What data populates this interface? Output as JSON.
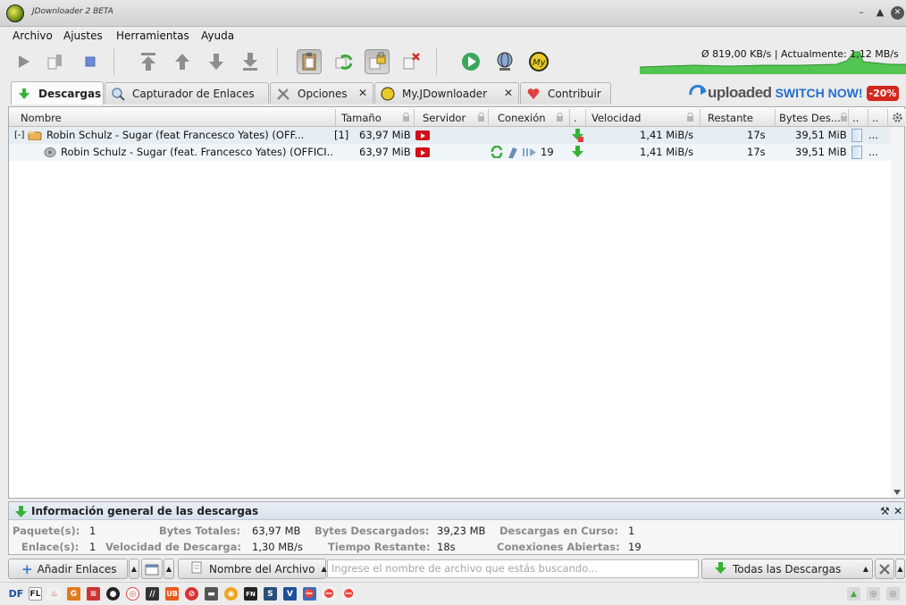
{
  "window": {
    "title": "JDownloader 2 BETA"
  },
  "menu": [
    "Archivo",
    "Ajustes",
    "Herramientas",
    "Ayuda"
  ],
  "speed": {
    "text": "Ø 819,00 KB/s | Actualmente: 1,12 MB/s"
  },
  "tabs": [
    {
      "label": "Descargas"
    },
    {
      "label": "Capturador de Enlaces"
    },
    {
      "label": "Opciones"
    },
    {
      "label": "My.JDownloader"
    },
    {
      "label": "Contribuir"
    }
  ],
  "ad": {
    "brand": "uploaded",
    "cta": "SWITCH NOW!",
    "badge": "-20%"
  },
  "columns": [
    "Nombre",
    "Tamaño",
    "Servidor",
    "Conexión",
    "Velocidad",
    "Restante",
    "Bytes Des..."
  ],
  "rows": {
    "package": {
      "expander": "[-]",
      "name": "Robin Schulz - Sugar (feat  Francesco Yates) (OFF...",
      "count": "[1]",
      "size": "63,97 MiB",
      "speed": "1,41 MiB/s",
      "remaining": "17s",
      "bytes": "39,51 MiB",
      "more": "..."
    },
    "link": {
      "name": "Robin Schulz - Sugar (feat. Francesco Yates) (OFFICI...",
      "size": "63,97 MiB",
      "connections": "19",
      "speed": "1,41 MiB/s",
      "remaining": "17s",
      "bytes": "39,51 MiB",
      "more": "..."
    }
  },
  "info": {
    "title": "Información general de las descargas",
    "labels": {
      "packages": "Paquete(s):",
      "links": "Enlace(s):",
      "total_bytes": "Bytes Totales:",
      "speed": "Velocidad de Descarga:",
      "loaded_bytes": "Bytes Descargados:",
      "remaining": "Tiempo Restante:",
      "running": "Descargas en Curso:",
      "connections": "Conexiones Abiertas:"
    },
    "values": {
      "packages": "1",
      "links": "1",
      "total_bytes": "63,97 MB",
      "speed": "1,30 MB/s",
      "loaded_bytes": "39,23 MB",
      "remaining": "18s",
      "running": "1",
      "connections": "19"
    }
  },
  "bottom": {
    "add_links": "Añadir Enlaces",
    "sort_by": "Nombre del Archivo",
    "search_placeholder": "Ingrese el nombre de archivo que estás buscando...",
    "filter": "Todas las Descargas"
  },
  "status_icons": [
    "DF",
    "FL",
    "UB",
    "FN",
    "V"
  ]
}
